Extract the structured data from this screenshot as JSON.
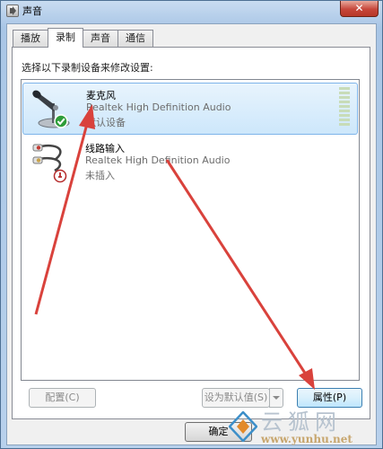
{
  "window": {
    "title": "声音",
    "close_glyph": "✕"
  },
  "tabs": [
    {
      "label": "播放",
      "active": false
    },
    {
      "label": "录制",
      "active": true
    },
    {
      "label": "声音",
      "active": false
    },
    {
      "label": "通信",
      "active": false
    }
  ],
  "instruction": "选择以下录制设备来修改设置:",
  "devices": [
    {
      "name": "麦克风",
      "driver": "Realtek High Definition Audio",
      "status": "默认设备",
      "icon": "microphone-icon",
      "badge": "default-check-icon",
      "selected": true
    },
    {
      "name": "线路输入",
      "driver": "Realtek High Definition Audio",
      "status": "未插入",
      "icon": "line-in-cable-icon",
      "badge": "unplugged-icon",
      "selected": false
    }
  ],
  "buttons": {
    "configure": "配置(C)",
    "set_default": "设为默认值(S)",
    "properties": "属性(P)",
    "ok": "确定"
  },
  "watermark": {
    "title": "云狐网",
    "url": "www.yunhu.net"
  },
  "colors": {
    "selection": "#cde7fb",
    "annotation_arrow": "#d9423c",
    "default_check": "#2e9d3a"
  }
}
